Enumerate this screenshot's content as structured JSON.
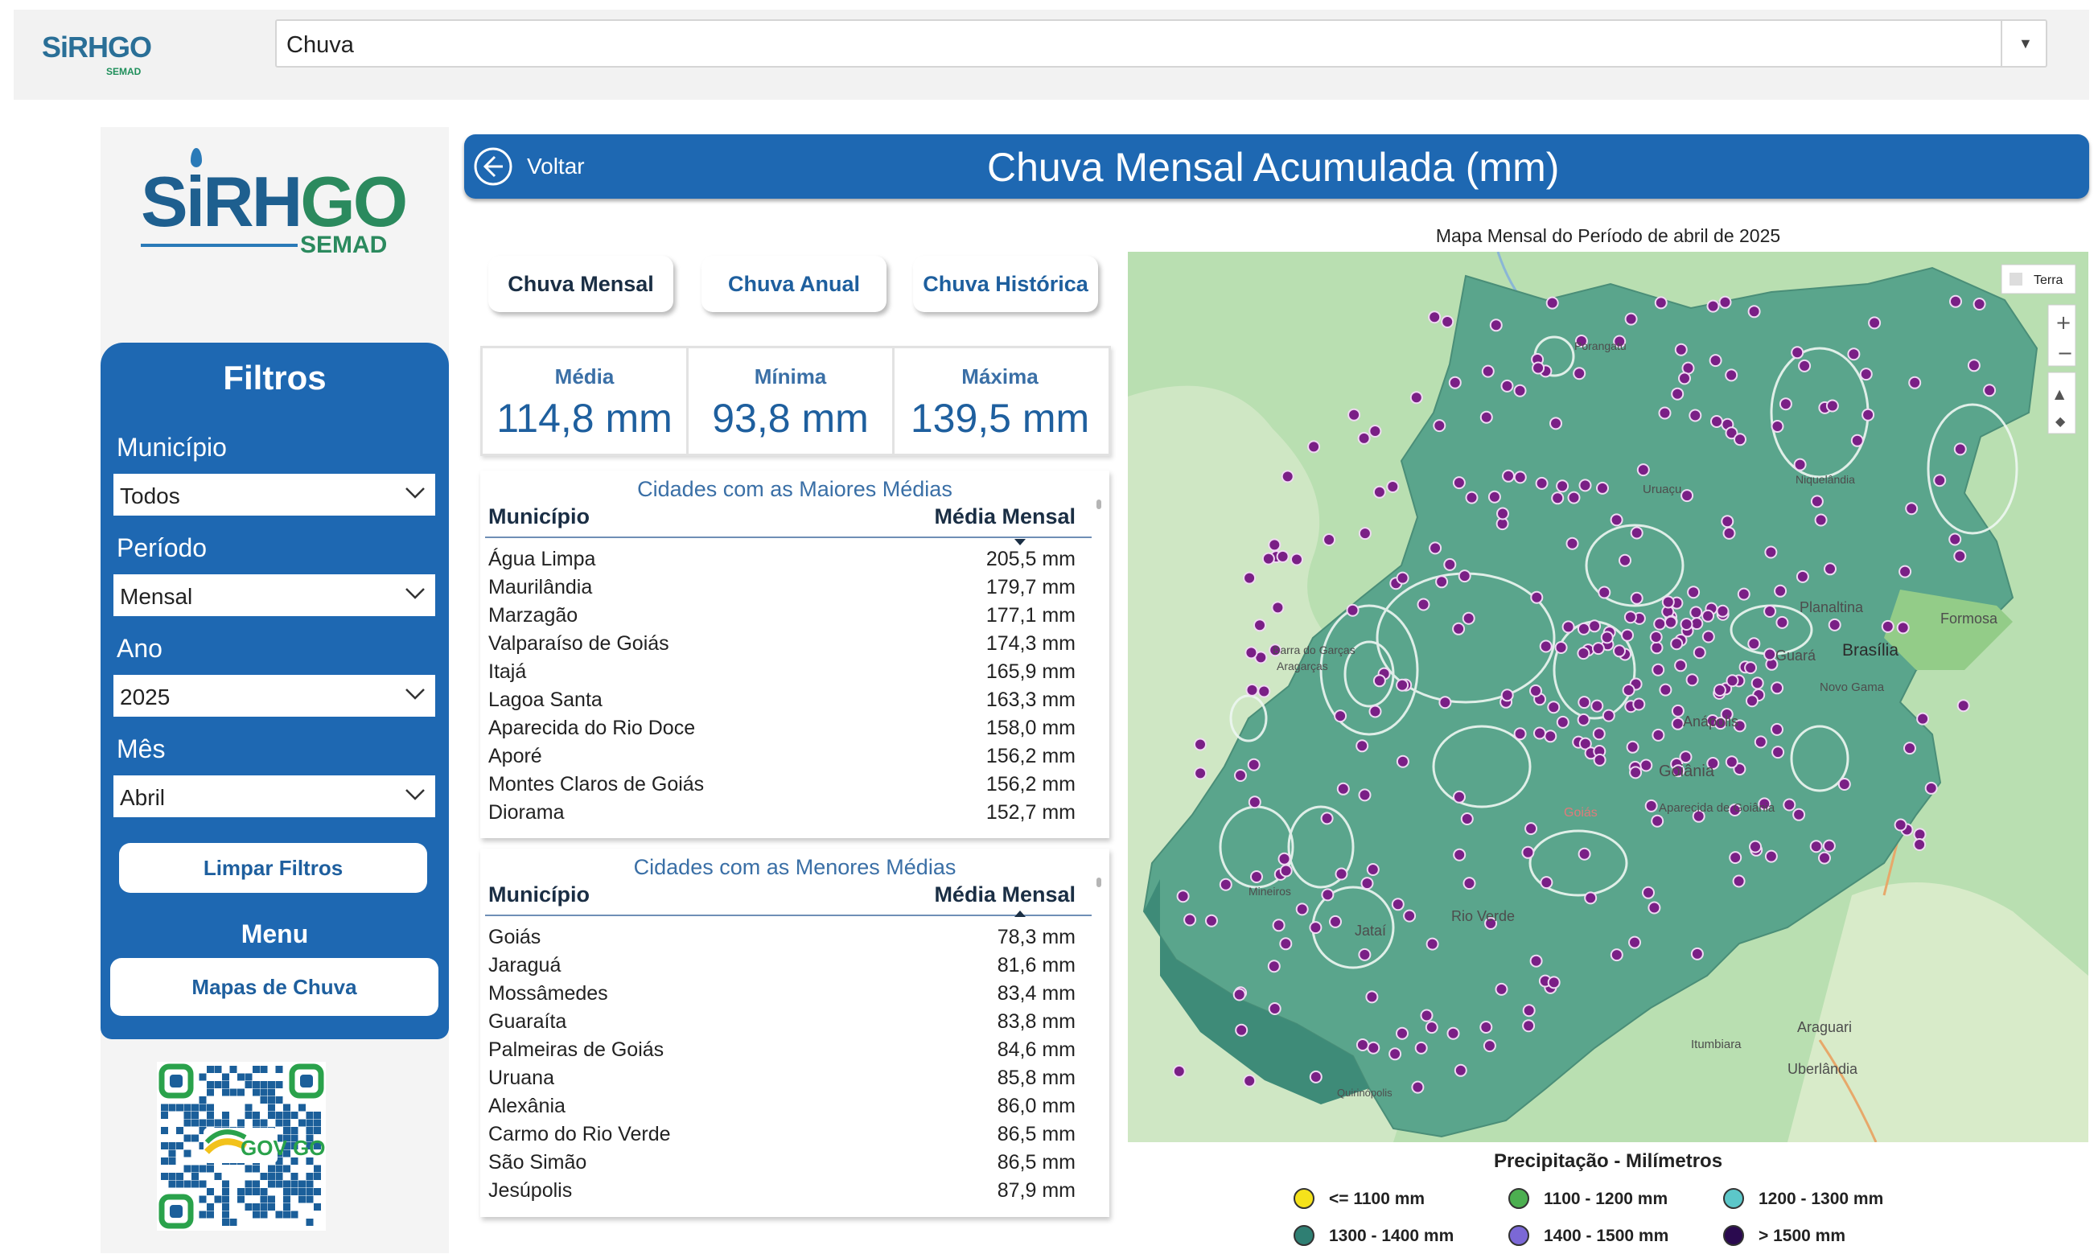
{
  "topbar": {
    "logo_main": "SiRHGO",
    "logo_sub": "SEMAD",
    "select_value": "Chuva"
  },
  "sidebar": {
    "logo_main_a": "SiRH",
    "logo_main_b": "GO",
    "logo_sub": "SEMAD",
    "filters_title": "Filtros",
    "municipio_label": "Município",
    "municipio_value": "Todos",
    "periodo_label": "Período",
    "periodo_value": "Mensal",
    "ano_label": "Ano",
    "ano_value": "2025",
    "mes_label": "Mês",
    "mes_value": "Abril",
    "clear_button": "Limpar Filtros",
    "menu_title": "Menu",
    "menu_button": "Mapas de Chuva",
    "qr_label": "GOV GO"
  },
  "header": {
    "back_label": "Voltar",
    "title": "Chuva Mensal Acumulada (mm)"
  },
  "tabs": [
    {
      "label": "Chuva Mensal",
      "active": true
    },
    {
      "label": "Chuva Anual",
      "active": false
    },
    {
      "label": "Chuva Histórica",
      "active": false
    }
  ],
  "kpis": [
    {
      "label": "Média",
      "value": "114,8 mm"
    },
    {
      "label": "Mínima",
      "value": "93,8 mm"
    },
    {
      "label": "Máxima",
      "value": "139,5 mm"
    }
  ],
  "top_table": {
    "title": "Cidades com as Maiores Médias",
    "col1": "Município",
    "col2": "Média Mensal",
    "rows": [
      [
        "Água Limpa",
        "205,5 mm"
      ],
      [
        "Maurilândia",
        "179,7 mm"
      ],
      [
        "Marzagão",
        "177,1 mm"
      ],
      [
        "Valparaíso de Goiás",
        "174,3 mm"
      ],
      [
        "Itajá",
        "165,9 mm"
      ],
      [
        "Lagoa Santa",
        "163,3 mm"
      ],
      [
        "Aparecida do Rio Doce",
        "158,0 mm"
      ],
      [
        "Aporé",
        "156,2 mm"
      ],
      [
        "Montes Claros de Goiás",
        "156,2 mm"
      ],
      [
        "Diorama",
        "152,7 mm"
      ]
    ]
  },
  "bottom_table": {
    "title": "Cidades com as Menores Médias",
    "col1": "Município",
    "col2": "Média Mensal",
    "rows": [
      [
        "Goiás",
        "78,3 mm"
      ],
      [
        "Jaraguá",
        "81,6 mm"
      ],
      [
        "Mossâmedes",
        "83,4 mm"
      ],
      [
        "Guaraíta",
        "83,8 mm"
      ],
      [
        "Palmeiras de Goiás",
        "84,6 mm"
      ],
      [
        "Uruana",
        "85,8 mm"
      ],
      [
        "Alexânia",
        "86,0 mm"
      ],
      [
        "Carmo do Rio Verde",
        "86,5 mm"
      ],
      [
        "São Simão",
        "86,5 mm"
      ],
      [
        "Jesúpolis",
        "87,9 mm"
      ]
    ]
  },
  "map": {
    "title": "Mapa Mensal do Período de abril de 2025",
    "layer_label": "Terra",
    "places": [
      "Brasília",
      "Goiânia",
      "Anápolis",
      "Rio Verde",
      "Jataí",
      "Formosa",
      "Planaltina",
      "Guará",
      "Novo Gama",
      "Aparecida de Goiânia",
      "Goiás",
      "Itumbiara",
      "Uberlândia",
      "Araguari",
      "Porangatu",
      "Uruaçu",
      "Niquelândia",
      "Aragarças",
      "Barra do Garças",
      "Mineiros",
      "Quirinópolis"
    ],
    "legend_title": "Precipitação - Milímetros",
    "legend": [
      {
        "label": "<= 1100 mm",
        "color": "#f5e21b"
      },
      {
        "label": "1100 - 1200 mm",
        "color": "#4caf50"
      },
      {
        "label": "1200 - 1300 mm",
        "color": "#5cc7c9"
      },
      {
        "label": "1300 - 1400 mm",
        "color": "#2f7f73"
      },
      {
        "label": "1400 - 1500 mm",
        "color": "#7b68d6"
      },
      {
        "label": "> 1500 mm",
        "color": "#2a0a4f"
      }
    ],
    "colors": {
      "state_fill": "#5aa58c",
      "outside_fill": "#b9dfb1",
      "station_dot": "#7a1f86"
    }
  }
}
